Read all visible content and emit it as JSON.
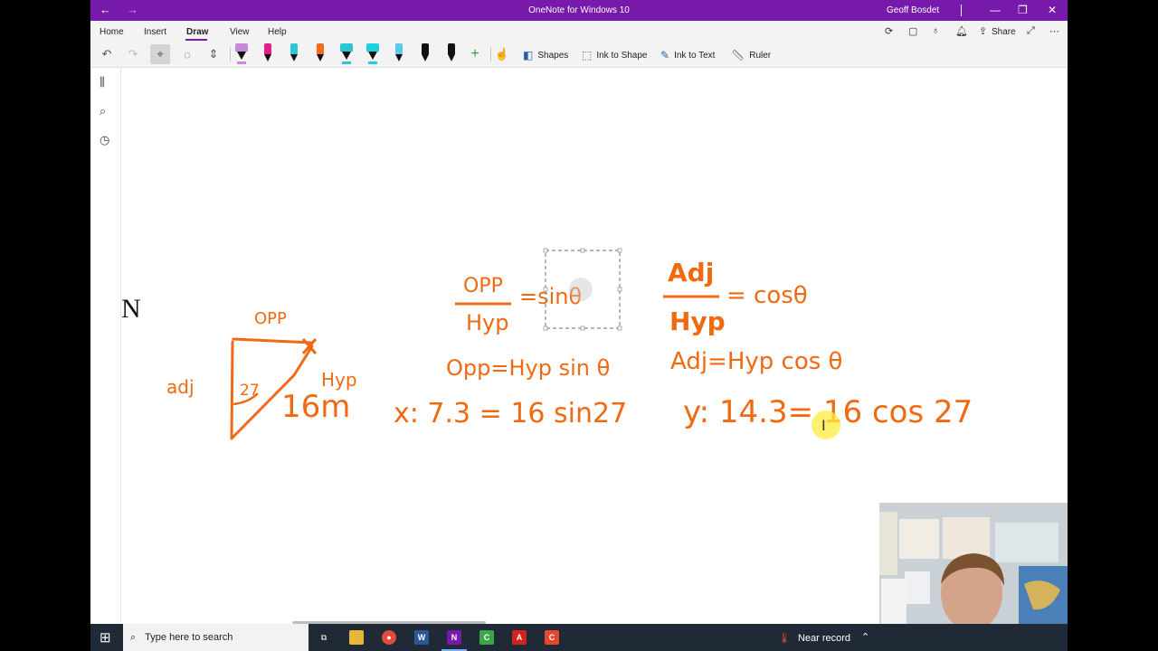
{
  "window": {
    "title": "OneNote for Windows 10",
    "user": "Geoff Bosdet",
    "back_glyph": "←",
    "forward_glyph": "→",
    "minimize_glyph": "—",
    "restore_glyph": "❐",
    "close_glyph": "✕"
  },
  "menu": {
    "tabs": [
      "Home",
      "Insert",
      "Draw",
      "View",
      "Help"
    ],
    "active_tab": "Draw",
    "share_label": "Share"
  },
  "toolbar": {
    "shapes_label": "Shapes",
    "ink_to_shape_label": "Ink to Shape",
    "ink_to_text_label": "Ink to Text",
    "ruler_label": "Ruler",
    "pens": [
      {
        "type": "highlighter",
        "color": "#c58bd8"
      },
      {
        "type": "pen",
        "color": "#e0208a"
      },
      {
        "type": "pen",
        "color": "#2ec4d6"
      },
      {
        "type": "pen",
        "color": "#f26a1b"
      },
      {
        "type": "highlighter",
        "color": "#2ec4d6"
      },
      {
        "type": "highlighter",
        "color": "#1fd0e0"
      },
      {
        "type": "pen",
        "color": "#5ac8e8"
      },
      {
        "type": "pen",
        "color": "#111111"
      },
      {
        "type": "pen",
        "color": "#111111"
      }
    ]
  },
  "canvas": {
    "side_letter": "N",
    "ink_color": "#f06a12",
    "notes": {
      "opp": "OPP",
      "hyp": "Hyp",
      "adj": "Adj",
      "sin_theta": "=sinθ",
      "cos_theta": "= cosθ",
      "tri_opp": "OPP",
      "tri_adj": "adj",
      "tri_angle": "27",
      "tri_hyp": "Hyp",
      "tri_len": "16m",
      "eq_opp": "Opp=Hyp sin θ",
      "eq_adj": "Adj=Hyp cos θ",
      "eq_x": "x: 7.3 = 16 sin27",
      "eq_y": "y: 14.3= 16 cos 27"
    }
  },
  "taskbar": {
    "search_placeholder": "Type here to search",
    "weather_label": "Near record",
    "apps": [
      "task-view",
      "file-explorer",
      "chrome",
      "word",
      "onenote",
      "camtasia",
      "acrobat",
      "recorder"
    ]
  }
}
